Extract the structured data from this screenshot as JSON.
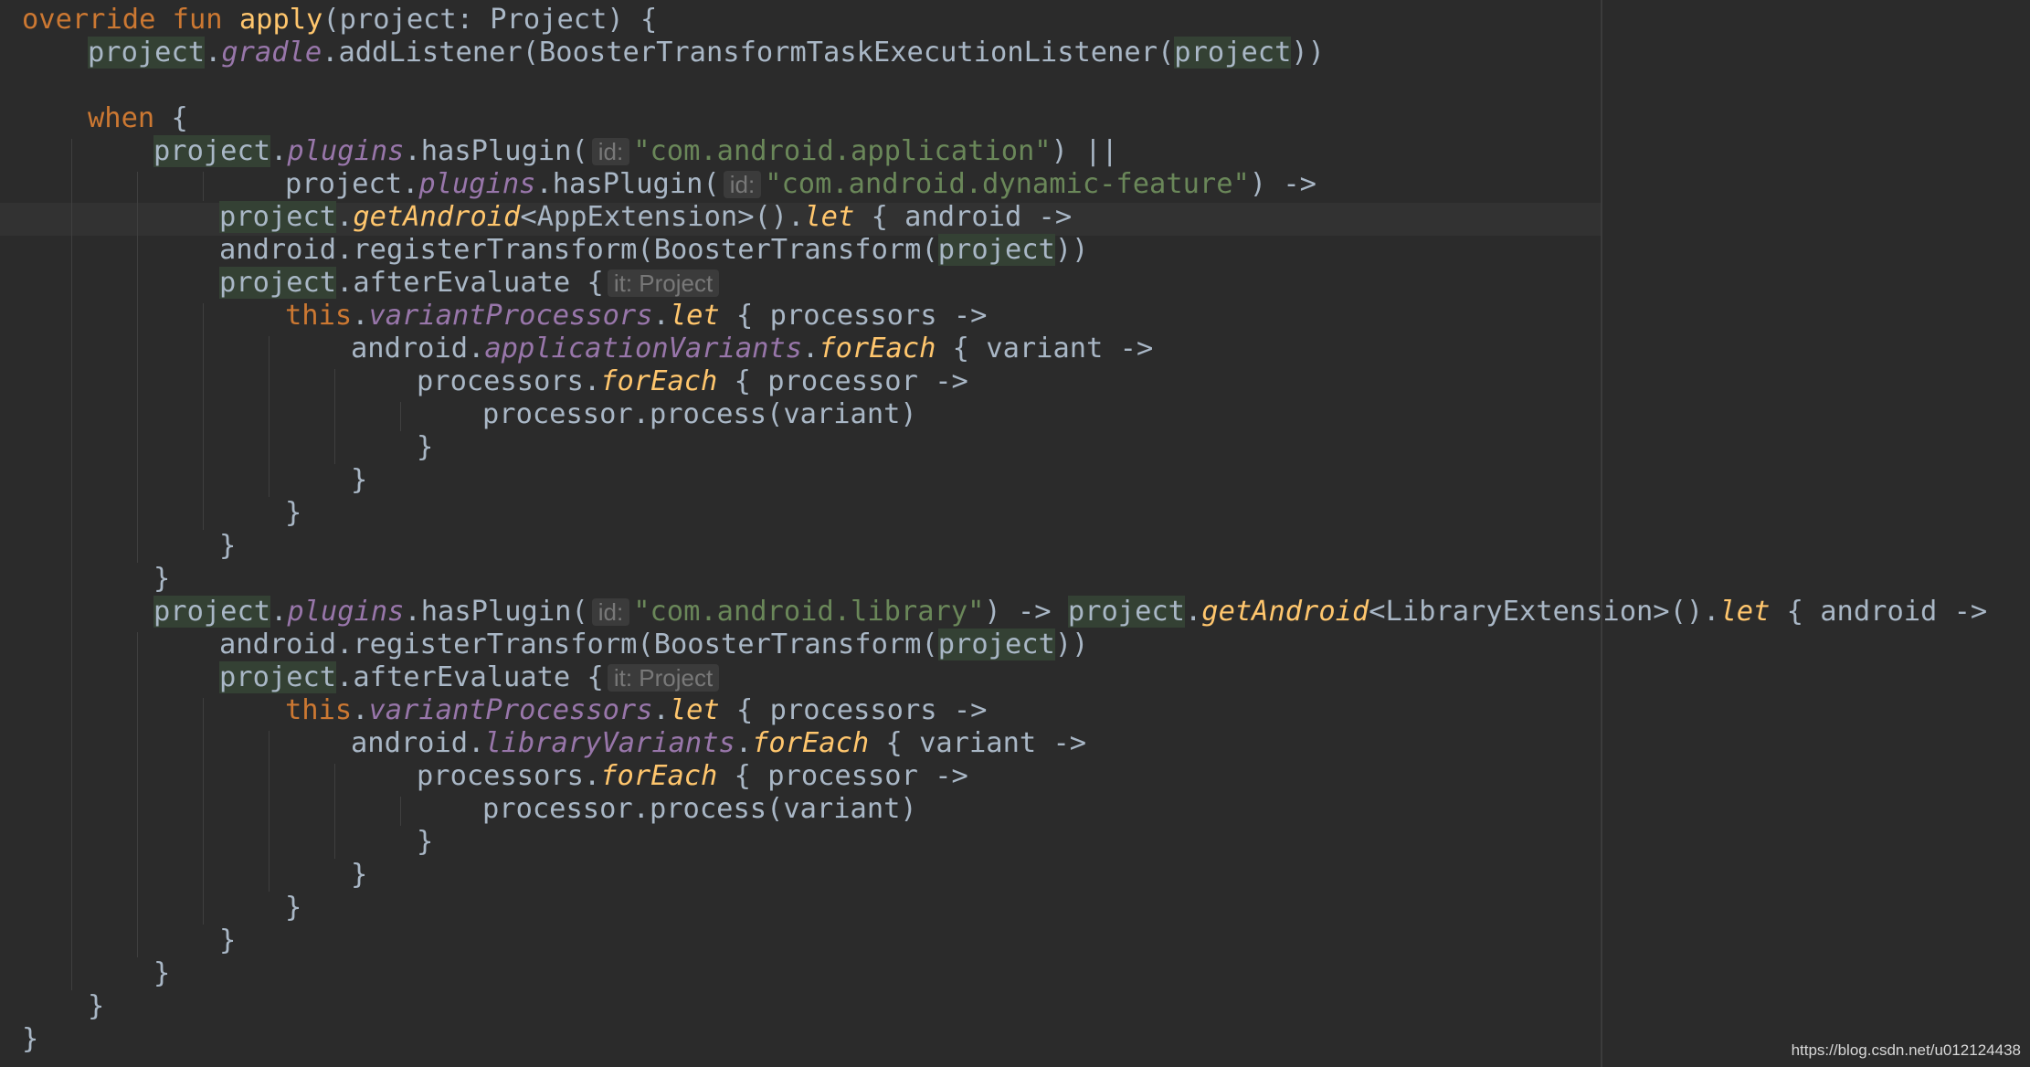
{
  "editor": {
    "lines": [
      {
        "indent": 0,
        "tokens": [
          {
            "t": "override fun ",
            "c": "kw"
          },
          {
            "t": "apply",
            "c": "fn"
          },
          {
            "t": "(project: Project) {"
          }
        ]
      },
      {
        "indent": 1,
        "tokens": [
          {
            "t": "project",
            "c": "param"
          },
          {
            "t": "."
          },
          {
            "t": "gradle",
            "c": "prop"
          },
          {
            "t": ".addListener(BoosterTransformTaskExecutionListener("
          },
          {
            "t": "project",
            "c": "param"
          },
          {
            "t": "))"
          }
        ]
      },
      {
        "indent": 0,
        "tokens": []
      },
      {
        "indent": 1,
        "tokens": [
          {
            "t": "when",
            "c": "kw"
          },
          {
            "t": " {"
          }
        ]
      },
      {
        "indent": 2,
        "tokens": [
          {
            "t": "project",
            "c": "param"
          },
          {
            "t": "."
          },
          {
            "t": "plugins",
            "c": "prop"
          },
          {
            "t": ".hasPlugin("
          },
          {
            "t": "id:",
            "c": "hint"
          },
          {
            "t": "\"com.android.application\"",
            "c": "str"
          },
          {
            "t": ") ||"
          }
        ]
      },
      {
        "indent": 4,
        "tokens": [
          {
            "t": "project"
          },
          {
            "t": "."
          },
          {
            "t": "plugins",
            "c": "prop"
          },
          {
            "t": ".hasPlugin("
          },
          {
            "t": "id:",
            "c": "hint"
          },
          {
            "t": "\"com.android.dynamic-feature\"",
            "c": "str"
          },
          {
            "t": ") ->"
          }
        ]
      },
      {
        "indent": 3,
        "caret": true,
        "tokens": [
          {
            "t": "project",
            "c": "param"
          },
          {
            "t": "."
          },
          {
            "t": "getAndroid",
            "c": "ext"
          },
          {
            "t": "<AppExtension>()."
          },
          {
            "t": "let",
            "c": "ext"
          },
          {
            "t": " { android ->"
          }
        ]
      },
      {
        "indent": 3,
        "tokens": [
          {
            "t": "android.registerTransform(BoosterTransform("
          },
          {
            "t": "project",
            "c": "param"
          },
          {
            "t": "))"
          }
        ]
      },
      {
        "indent": 3,
        "tokens": [
          {
            "t": "project",
            "c": "param"
          },
          {
            "t": ".afterEvaluate {"
          },
          {
            "t": "it: Project",
            "c": "hint"
          }
        ]
      },
      {
        "indent": 4,
        "tokens": [
          {
            "t": "this",
            "c": "kw"
          },
          {
            "t": "."
          },
          {
            "t": "variantProcessors",
            "c": "prop"
          },
          {
            "t": "."
          },
          {
            "t": "let",
            "c": "ext"
          },
          {
            "t": " { processors ->"
          }
        ]
      },
      {
        "indent": 5,
        "tokens": [
          {
            "t": "android."
          },
          {
            "t": "applicationVariants",
            "c": "prop"
          },
          {
            "t": "."
          },
          {
            "t": "forEach",
            "c": "ext"
          },
          {
            "t": " { variant ->"
          }
        ]
      },
      {
        "indent": 6,
        "tokens": [
          {
            "t": "processors."
          },
          {
            "t": "forEach",
            "c": "ext"
          },
          {
            "t": " { processor ->"
          }
        ]
      },
      {
        "indent": 7,
        "tokens": [
          {
            "t": "processor.process(variant)"
          }
        ]
      },
      {
        "indent": 6,
        "tokens": [
          {
            "t": "}"
          }
        ]
      },
      {
        "indent": 5,
        "tokens": [
          {
            "t": "}"
          }
        ]
      },
      {
        "indent": 4,
        "tokens": [
          {
            "t": "}"
          }
        ]
      },
      {
        "indent": 3,
        "tokens": [
          {
            "t": "}"
          }
        ]
      },
      {
        "indent": 2,
        "tokens": [
          {
            "t": "}"
          }
        ]
      },
      {
        "indent": 2,
        "tokens": [
          {
            "t": "project",
            "c": "param"
          },
          {
            "t": "."
          },
          {
            "t": "plugins",
            "c": "prop"
          },
          {
            "t": ".hasPlugin("
          },
          {
            "t": "id:",
            "c": "hint"
          },
          {
            "t": "\"com.android.library\"",
            "c": "str"
          },
          {
            "t": ") -> "
          },
          {
            "t": "project",
            "c": "param"
          },
          {
            "t": "."
          },
          {
            "t": "getAndroid",
            "c": "ext"
          },
          {
            "t": "<LibraryExtension>()."
          },
          {
            "t": "let",
            "c": "ext"
          },
          {
            "t": " { android ->"
          }
        ]
      },
      {
        "indent": 3,
        "tokens": [
          {
            "t": "android.registerTransform(BoosterTransform("
          },
          {
            "t": "project",
            "c": "param"
          },
          {
            "t": "))"
          }
        ]
      },
      {
        "indent": 3,
        "tokens": [
          {
            "t": "project",
            "c": "param"
          },
          {
            "t": ".afterEvaluate {"
          },
          {
            "t": "it: Project",
            "c": "hint"
          }
        ]
      },
      {
        "indent": 4,
        "tokens": [
          {
            "t": "this",
            "c": "kw"
          },
          {
            "t": "."
          },
          {
            "t": "variantProcessors",
            "c": "prop"
          },
          {
            "t": "."
          },
          {
            "t": "let",
            "c": "ext"
          },
          {
            "t": " { processors ->"
          }
        ]
      },
      {
        "indent": 5,
        "tokens": [
          {
            "t": "android."
          },
          {
            "t": "libraryVariants",
            "c": "prop"
          },
          {
            "t": "."
          },
          {
            "t": "forEach",
            "c": "ext"
          },
          {
            "t": " { variant ->"
          }
        ]
      },
      {
        "indent": 6,
        "tokens": [
          {
            "t": "processors."
          },
          {
            "t": "forEach",
            "c": "ext"
          },
          {
            "t": " { processor ->"
          }
        ]
      },
      {
        "indent": 7,
        "tokens": [
          {
            "t": "processor.process(variant)"
          }
        ]
      },
      {
        "indent": 6,
        "tokens": [
          {
            "t": "}"
          }
        ]
      },
      {
        "indent": 5,
        "tokens": [
          {
            "t": "}"
          }
        ]
      },
      {
        "indent": 4,
        "tokens": [
          {
            "t": "}"
          }
        ]
      },
      {
        "indent": 3,
        "tokens": [
          {
            "t": "}"
          }
        ]
      },
      {
        "indent": 2,
        "tokens": [
          {
            "t": "}"
          }
        ]
      },
      {
        "indent": 1,
        "tokens": [
          {
            "t": "}"
          }
        ]
      },
      {
        "indent": 0,
        "tokens": [
          {
            "t": "}"
          }
        ]
      }
    ]
  },
  "watermark": "https://blog.csdn.net/u012124438",
  "colors": {
    "background": "#2b2b2b",
    "text": "#a9b7c6",
    "keyword": "#cc7832",
    "function": "#ffc66d",
    "property": "#9876aa",
    "string": "#6a8759",
    "param_highlight": "#344134",
    "hint": "#787878"
  }
}
